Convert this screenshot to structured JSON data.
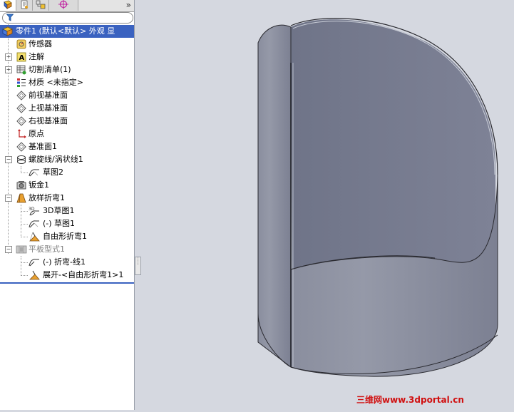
{
  "tabs": [
    {
      "name": "feature-manager",
      "icon": "feature-tree-icon",
      "active": true
    },
    {
      "name": "property-manager",
      "icon": "property-icon",
      "active": false
    },
    {
      "name": "configuration-manager",
      "icon": "configuration-icon",
      "active": false
    },
    {
      "name": "dim-xpert-manager",
      "icon": "crosshair-target-icon",
      "active": false
    }
  ],
  "tabs_more": "»",
  "tree": {
    "root": "零件1  (默认<默认> 外观 显",
    "items": [
      {
        "label": "传感器",
        "icon": "sensor-icon"
      },
      {
        "label": "注解",
        "icon": "annotation-icon"
      },
      {
        "label": "切割清单(1)",
        "icon": "cut-list-icon"
      },
      {
        "label": "材质 <未指定>",
        "icon": "material-icon"
      },
      {
        "label": "前视基准面",
        "icon": "plane-icon"
      },
      {
        "label": "上视基准面",
        "icon": "plane-icon"
      },
      {
        "label": "右视基准面",
        "icon": "plane-icon"
      },
      {
        "label": "原点",
        "icon": "origin-icon"
      },
      {
        "label": "基准面1",
        "icon": "plane-icon"
      },
      {
        "label": "螺旋线/涡状线1",
        "icon": "helix-icon"
      },
      {
        "label": "草图2",
        "icon": "sketch-icon"
      },
      {
        "label": "钣金1",
        "icon": "sheet-metal-icon"
      },
      {
        "label": "放样折弯1",
        "icon": "lofted-bend-icon"
      },
      {
        "label": "3D草图1",
        "icon": "sketch-3d-icon"
      },
      {
        "label": "(-) 草图1",
        "icon": "sketch-icon"
      },
      {
        "label": "自由形折弯1",
        "icon": "freeform-bend-icon"
      },
      {
        "label": "平板型式1",
        "icon": "flat-pattern-icon"
      },
      {
        "label": "(-) 折弯-线1",
        "icon": "bend-line-sketch-icon"
      },
      {
        "label": "展开-<自由形折弯1>1",
        "icon": "unfold-icon"
      }
    ]
  },
  "watermark": "三维网www.3dportal.cn",
  "colors": {
    "viewport_bg": "#d5d8e0",
    "part_face": "#8a8e9c",
    "part_inner": "#70758a",
    "selection": "#3a62c0",
    "watermark": "#d01010"
  }
}
